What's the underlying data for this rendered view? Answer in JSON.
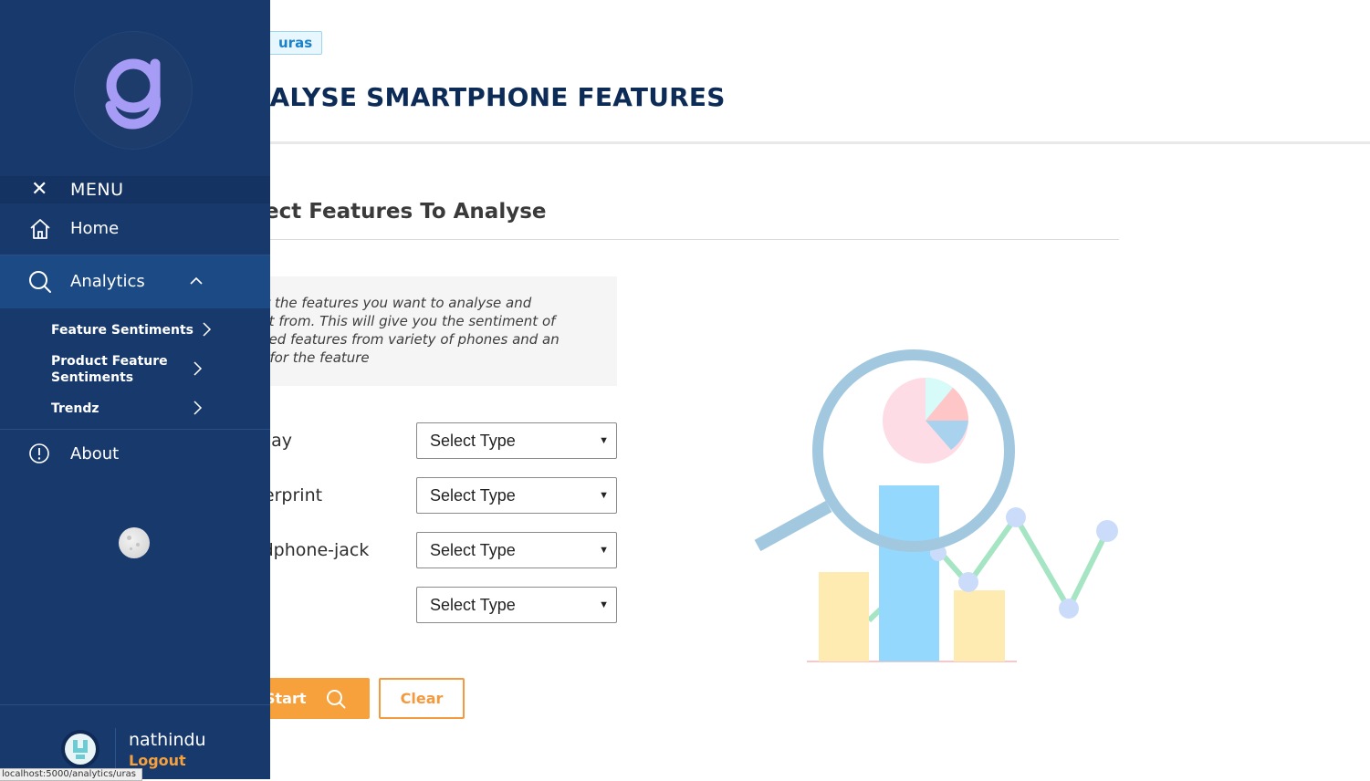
{
  "main": {
    "breadcrumb": "uras",
    "page_title": "ANALYSE SMARTPHONE FEATURES",
    "section_title": "Select Features To Analyse",
    "info_lines": [
      "Select the features you want to analyse and",
      "insight from. This will give you the sentiment of",
      "selected features from variety of phones and an",
      "score for the feature"
    ],
    "features": [
      {
        "label": "Display",
        "select_value": "Select Type"
      },
      {
        "label": "Fingerprint",
        "select_value": "Select Type"
      },
      {
        "label": "Headphone-jack",
        "select_value": "Select Type"
      },
      {
        "label": "",
        "select_value": "Select Type"
      }
    ],
    "analyse_button": "Start Analysing",
    "clear_button": "Clear"
  },
  "sidebar": {
    "menu_label": "MENU",
    "home_label": "Home",
    "analytics_label": "Analytics",
    "sub_items": [
      {
        "label": "Feature Sentiments"
      },
      {
        "label": "Product Feature Sentiments"
      },
      {
        "label": "Trendz"
      }
    ],
    "about_label": "About",
    "user_name": "nathindu",
    "logout_label": "Logout"
  },
  "status_bar": {
    "url": "localhost:5000/analytics/uras"
  },
  "colors": {
    "sidebar": "#17396c",
    "accent_orange": "#f7a13d",
    "title_navy": "#0d2b57",
    "logo_purple": "#a69bf5"
  }
}
